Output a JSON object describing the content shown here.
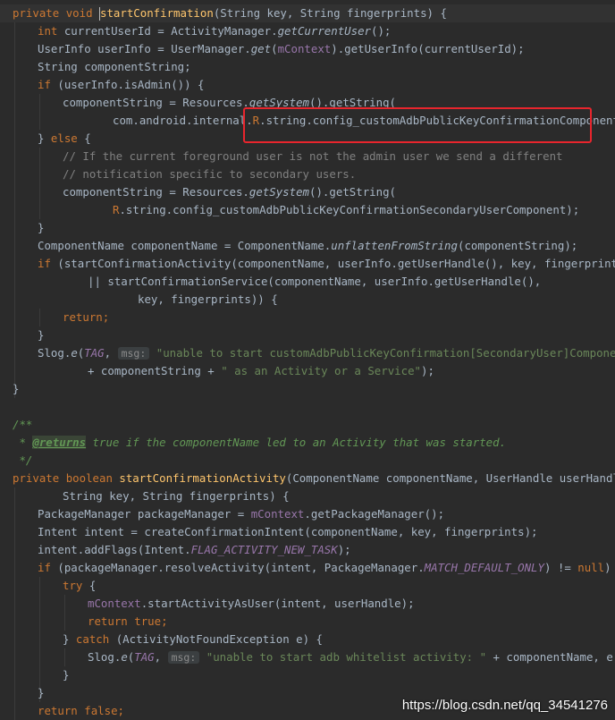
{
  "code": {
    "l1_private": "private",
    "l1_void": "void",
    "l1_name": "startConfirmation",
    "l1_rest": "(String key, String fingerprints) {",
    "l2_int": "int",
    "l2_a": " currentUserId = ActivityManager.",
    "l2_call": "getCurrentUser",
    "l2_b": "();",
    "l3_a": "UserInfo userInfo = UserManager.",
    "l3_get": "get",
    "l3_b": "(",
    "l3_ctx": "mContext",
    "l3_c": ").getUserInfo(currentUserId);",
    "l4": "String componentString;",
    "l5_if": "if",
    "l5_rest": " (userInfo.isAdmin()) {",
    "l6_a": "componentString = Resources.",
    "l6_sys": "getSystem",
    "l6_b": "().getString(",
    "l7_a": "com.android.internal.",
    "l7_r": "R",
    "l7_b": ".string.config_customAdbPublicKeyConfirmationComponent",
    "l7_c": ");",
    "l8_a": "} ",
    "l8_else": "else",
    "l8_b": " {",
    "l9": "// If the current foreground user is not the admin user we send a different",
    "l10": "// notification specific to secondary users.",
    "l11_a": "componentString = Resources.",
    "l11_sys": "getSystem",
    "l11_b": "().getString(",
    "l12_r": "R",
    "l12_b": ".string.config_customAdbPublicKeyConfirmationSecondaryUserComponent);",
    "l13": "}",
    "l14_a": "ComponentName componentName = ComponentName.",
    "l14_fn": "unflattenFromString",
    "l14_b": "(componentString);",
    "l15_if": "if",
    "l15_rest": " (startConfirmationActivity(componentName, userInfo.getUserHandle(), key, fingerprints)",
    "l16": "|| startConfirmationService(componentName, userInfo.getUserHandle(),",
    "l17": "key, fingerprints)) {",
    "l18_ret": "return",
    "l18_b": ";",
    "l19": "}",
    "l20_a": "Slog.",
    "l20_e": "e",
    "l20_b": "(",
    "l20_tag": "TAG",
    "l20_c": ", ",
    "l20_hint": "msg:",
    "l20_str": "\"unable to start customAdbPublicKeyConfirmation[SecondaryUser]Component \"",
    "l21_a": "+ componentString + ",
    "l21_str": "\" as an Activity or a Service\"",
    "l21_b": ");",
    "l22": "}",
    "l24": "/**",
    "l25_star": " * ",
    "l25_tag": "@returns",
    "l25_rest": " true if the componentName led to an Activity that was started.",
    "l26": " */",
    "l27_private": "private",
    "l27_bool": "boolean",
    "l27_name": "startConfirmationActivity",
    "l27_rest": "(ComponentName componentName, UserHandle userHandle,",
    "l28": "String key, String fingerprints) {",
    "l29_a": "PackageManager packageManager = ",
    "l29_ctx": "mContext",
    "l29_b": ".getPackageManager();",
    "l30": "Intent intent = createConfirmationIntent(componentName, key, fingerprints);",
    "l31_a": "intent.addFlags(Intent.",
    "l31_flag": "FLAG_ACTIVITY_NEW_TASK",
    "l31_b": ");",
    "l32_if": "if",
    "l32_a": " (packageManager.resolveActivity(intent, PackageManager.",
    "l32_flag": "MATCH_DEFAULT_ONLY",
    "l32_b": ") != ",
    "l32_null": "null",
    "l32_c": ") {",
    "l33_try": "try",
    "l33_b": " {",
    "l34_ctx": "mContext",
    "l34_b": ".startActivityAsUser(intent, userHandle);",
    "l35_ret": "return",
    "l35_true": "true",
    "l35_b": ";",
    "l36_a": "} ",
    "l36_catch": "catch",
    "l36_b": " (ActivityNotFoundException e) {",
    "l37_a": "Slog.",
    "l37_e": "e",
    "l37_b": "(",
    "l37_tag": "TAG",
    "l37_c": ", ",
    "l37_hint": "msg:",
    "l37_str": "\"unable to start adb whitelist activity: \"",
    "l37_d": " + componentName, e);",
    "l38": "}",
    "l39": "}",
    "l40_ret": "return",
    "l40_false": "false",
    "l40_b": ";"
  },
  "watermark": "https://blog.csdn.net/qq_34541276",
  "colors": {
    "background": "#2b2b2b",
    "keyword": "#cc7832",
    "method_decl": "#ffc66d",
    "string": "#6a8759",
    "field": "#9876aa",
    "comment": "#808080",
    "javadoc": "#629755",
    "highlight_box": "#e8252d"
  }
}
